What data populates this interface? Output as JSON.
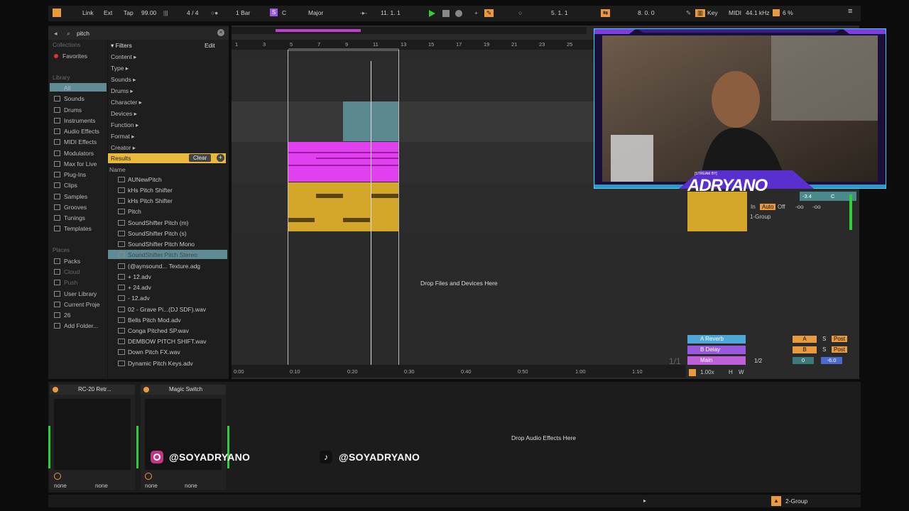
{
  "topbar": {
    "link": "Link",
    "ext": "Ext",
    "tap": "Tap",
    "tempo": "99.00",
    "signature": "4 / 4",
    "quantize": "1 Bar",
    "key_root": "C",
    "key_mode": "Major",
    "position": "11.   1.   1",
    "loop_start": "5.   1.   1",
    "loop_length": "8.   0.   0",
    "key_label": "Key",
    "midi_label": "MIDI",
    "sample_rate": "44.1 kHz",
    "cpu": "6 %",
    "scale_letter": "S"
  },
  "browser": {
    "search_value": "pitch",
    "collections_head": "Collections",
    "favorites": "Favorites",
    "library_head": "Library",
    "library": [
      "All",
      "Sounds",
      "Drums",
      "Instruments",
      "Audio Effects",
      "MIDI Effects",
      "Modulators",
      "Max for Live",
      "Plug-Ins",
      "Clips",
      "Samples",
      "Grooves",
      "Tunings",
      "Templates"
    ],
    "places_head": "Places",
    "places": [
      "Packs",
      "Cloud",
      "Push",
      "User Library",
      "Current Proje",
      "26",
      "Add Folder..."
    ],
    "filters_label": "Filters",
    "edit_label": "Edit",
    "filters": [
      "Content ▸",
      "Type ▸",
      "Sounds ▸",
      "Drums ▸",
      "Character ▸",
      "Devices ▸",
      "Function ▸",
      "Format ▸",
      "Creator ▸"
    ],
    "results_label": "Results",
    "clear_label": "Clear",
    "name_header": "Name",
    "results": [
      "AUNewPitch",
      "kHs Pitch Shifter",
      "kHs Pitch Shifter",
      "Pitch",
      "SoundShifter Pitch (m)",
      "SoundShifter Pitch (s)",
      "SoundShifter Pitch Mono",
      "SoundShifter Pitch Stereo",
      "(@aynsound... Texture.adg",
      "+ 12.adv",
      "+ 24.adv",
      "- 12.adv",
      "02 - Grave Pi...(DJ SDF).wav",
      "Bells Pitch Mod.adv",
      "Conga Pitched SP.wav",
      "DEMBOW PITCH SHIFT.wav",
      "Down Pitch FX.wav",
      "Dynamic Pitch Keys.adv"
    ]
  },
  "arrangement": {
    "bar_numbers": [
      "1",
      "3",
      "5",
      "7",
      "9",
      "11",
      "13",
      "15",
      "17",
      "19",
      "21",
      "23",
      "25"
    ],
    "time_labels": [
      "0:00",
      "0:10",
      "0:20",
      "0:30",
      "0:40",
      "0:50",
      "1:00",
      "1:10"
    ],
    "drop_files": "Drop Files and Devices Here",
    "page_indicator": "1/1",
    "zoom": "1.00x",
    "h_label": "H",
    "w_label": "W"
  },
  "mixer": {
    "volume_value": "-3.4",
    "key_value": "C",
    "in_label": "In",
    "auto_label": "Auto",
    "off_label": "Off",
    "inf1": "-oo",
    "inf2": "-oo",
    "group": "1-Group",
    "returns": [
      {
        "name": "A Reverb",
        "letter": "A",
        "s": "S",
        "post": "Post"
      },
      {
        "name": "B Delay",
        "letter": "B",
        "s": "S",
        "post": "Post"
      }
    ],
    "main": {
      "name": "Main",
      "routing": "1/2",
      "pan": "0",
      "volume": "-6.0"
    }
  },
  "devices": {
    "device1": "RC-20 Retr...",
    "device2": "Magic Switch",
    "none": "none",
    "drop_audio": "Drop Audio Effects Here"
  },
  "overlay": {
    "streamer_tag": "[STREAM BY]",
    "streamer": "ADRYANO",
    "instagram": "@SOYADRYANO",
    "tiktok": "@SOYADRYANO"
  },
  "statusbar": {
    "group": "2-Group"
  },
  "colors": {
    "accent_orange": "#e89a3c",
    "clip_magenta": "#e040ee",
    "clip_yellow": "#d4a62a",
    "clip_teal": "#5a8a90",
    "overlay_purple": "#7b3fe0",
    "overlay_cyan": "#3fd0ff"
  }
}
